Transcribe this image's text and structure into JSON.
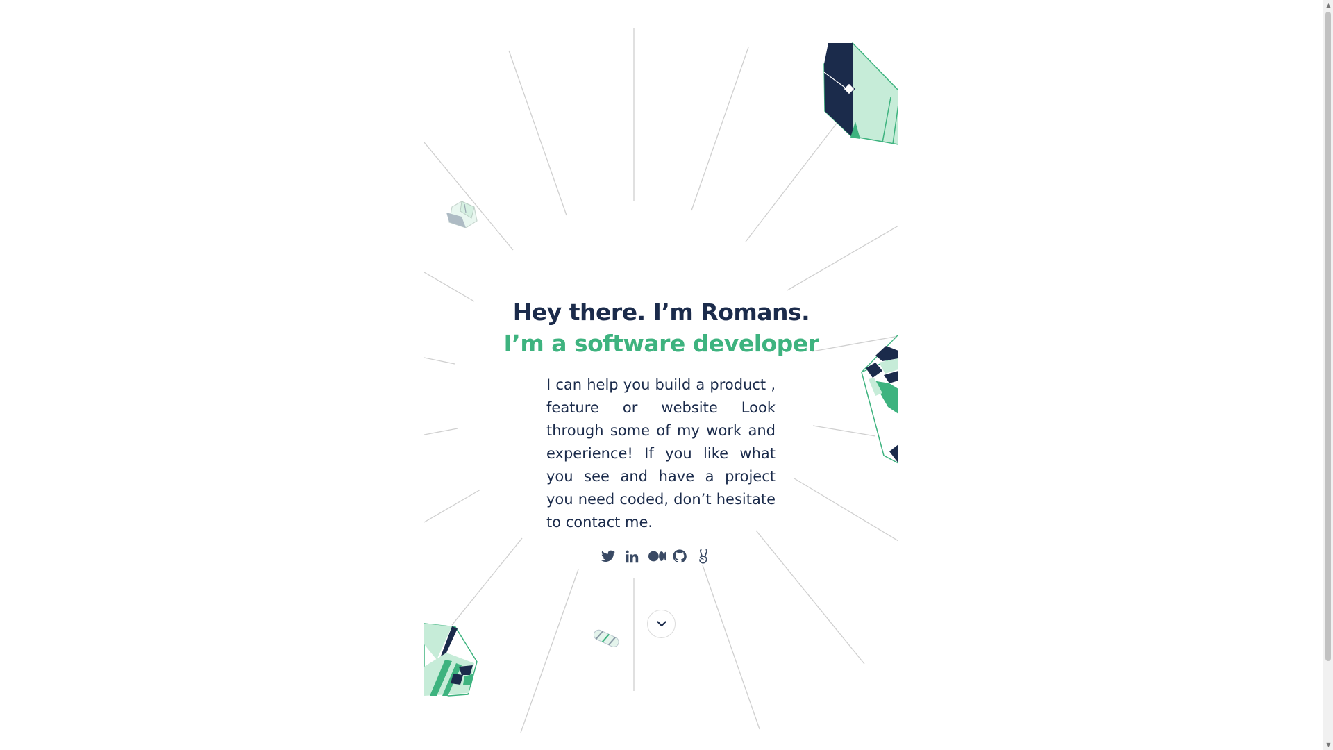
{
  "hero": {
    "greeting": "Hey there. I’m Romans.",
    "tagline": "I’m a software developer",
    "bio": "I can help you build a product , feature or website Look through some of my work and experience! If you like what you see and have a project you need coded, don’t hesitate to contact me."
  },
  "socials": [
    {
      "icon": "twitter-icon",
      "label": "Twitter"
    },
    {
      "icon": "linkedin-icon",
      "label": "LinkedIn"
    },
    {
      "icon": "medium-icon",
      "label": "Medium"
    },
    {
      "icon": "github-icon",
      "label": "GitHub"
    },
    {
      "icon": "angellist-icon",
      "label": "AngelList"
    }
  ],
  "scroll_down": {
    "icon": "chevron-down-icon"
  },
  "colors": {
    "navy": "#1b2b4b",
    "green": "#3eb37f",
    "mint": "#c6ecd8",
    "ray": "#d0d0d0"
  }
}
